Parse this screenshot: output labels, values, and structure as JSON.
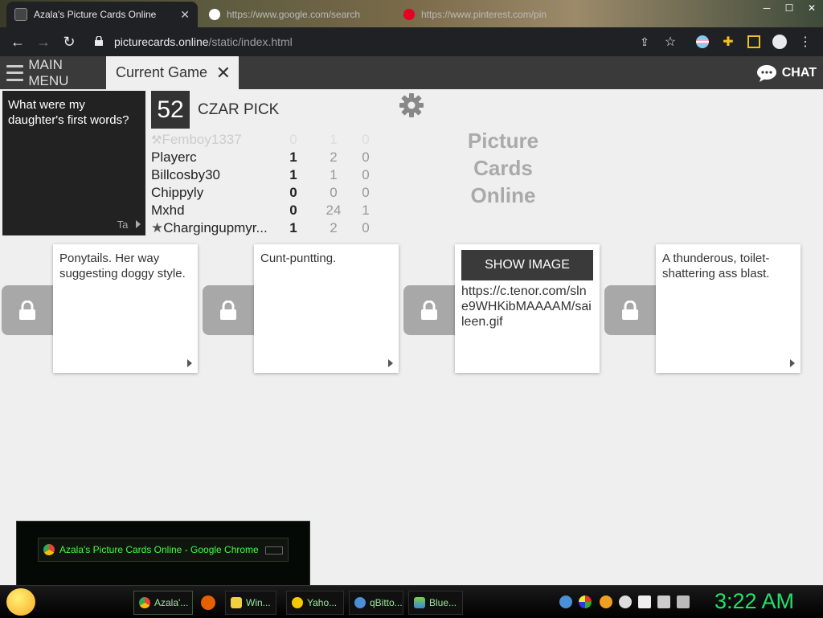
{
  "browser": {
    "tabs": [
      {
        "title": "Azala's Picture Cards Online",
        "active": true
      },
      {
        "title": "https://www.google.com/search",
        "active": false
      },
      {
        "title": "https://www.pinterest.com/pin",
        "active": false
      }
    ],
    "url_host": "picturecards.online",
    "url_path": "/static/index.html"
  },
  "app": {
    "main_menu": "MAIN MENU",
    "current_tab": "Current Game",
    "chat": "CHAT",
    "logo_lines": [
      "Picture",
      "Cards",
      "Online"
    ]
  },
  "question": {
    "text": "What were my daughter's first words?",
    "footer": "Ta"
  },
  "round": {
    "score": "52",
    "phase": "CZAR PICK"
  },
  "players": [
    {
      "name": "Femboy1337",
      "points": "0",
      "col2": "1",
      "col3": "0",
      "dim": true,
      "icon": "hammer-icon"
    },
    {
      "name": "Playerc",
      "points": "1",
      "col2": "2",
      "col3": "0"
    },
    {
      "name": "Billcosby30",
      "points": "1",
      "col2": "1",
      "col3": "0"
    },
    {
      "name": "Chippyly",
      "points": "0",
      "col2": "0",
      "col3": "0"
    },
    {
      "name": "Mxhd",
      "points": "0",
      "col2": "24",
      "col3": "1"
    },
    {
      "name": "Chargingupmyr...",
      "points": "1",
      "col2": "2",
      "col3": "0",
      "icon": "star-icon"
    }
  ],
  "answers": [
    {
      "text": "Ponytails. Her way suggesting doggy style."
    },
    {
      "text": "Cunt-puntting."
    },
    {
      "button": "SHOW IMAGE",
      "text": "https://c.tenor.com/slne9WHKibMAAAAM/saileen.gif"
    },
    {
      "text": "A thunderous, toilet-shattering ass blast."
    }
  ],
  "popup": {
    "title": "Azala's Picture Cards Online - Google Chrome"
  },
  "taskbar": {
    "items": [
      "Azala'...",
      "Win...",
      "Yaho...",
      "qBitto...",
      "Blue..."
    ],
    "clock": "3:22 AM"
  }
}
